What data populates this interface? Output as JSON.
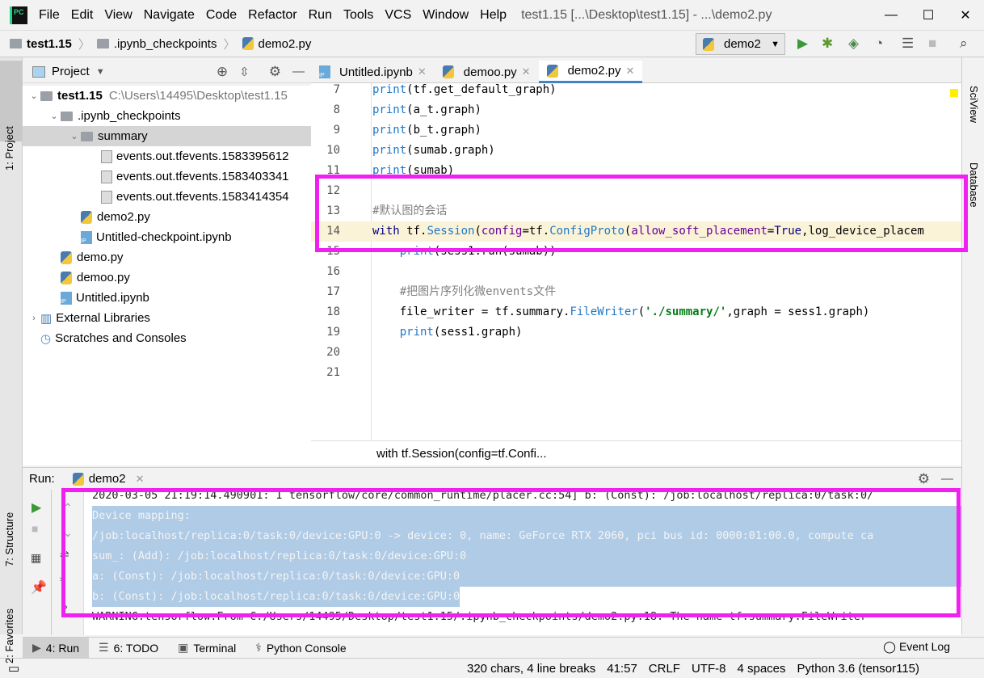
{
  "menu": {
    "items": [
      "File",
      "Edit",
      "View",
      "Navigate",
      "Code",
      "Refactor",
      "Run",
      "Tools",
      "VCS",
      "Window",
      "Help"
    ],
    "window_title": "test1.15 [...\\Desktop\\test1.15] - ...\\demo2.py"
  },
  "breadcrumb": [
    "test1.15",
    ".ipynb_checkpoints",
    "demo2.py"
  ],
  "run_config": "demo2",
  "left_stripe": {
    "project": "1: Project",
    "structure": "7: Structure",
    "favorites": "2: Favorites"
  },
  "right_stripe": {
    "sciview": "SciView",
    "database": "Database"
  },
  "project": {
    "title": "Project",
    "tree": [
      {
        "label": "test1.15",
        "path": "C:\\Users\\14495\\Desktop\\test1.15",
        "type": "folder",
        "depth": 0
      },
      {
        "label": ".ipynb_checkpoints",
        "type": "folder",
        "depth": 1
      },
      {
        "label": "summary",
        "type": "folder",
        "depth": 2,
        "selected": true
      },
      {
        "label": "events.out.tfevents.1583395612",
        "type": "file",
        "depth": 3
      },
      {
        "label": "events.out.tfevents.1583403341",
        "type": "file",
        "depth": 3
      },
      {
        "label": "events.out.tfevents.1583414354",
        "type": "file",
        "depth": 3
      },
      {
        "label": "demo2.py",
        "type": "py",
        "depth": 2
      },
      {
        "label": "Untitled-checkpoint.ipynb",
        "type": "ipynb",
        "depth": 2
      },
      {
        "label": "demo.py",
        "type": "py",
        "depth": 1
      },
      {
        "label": "demoo.py",
        "type": "py",
        "depth": 1
      },
      {
        "label": "Untitled.ipynb",
        "type": "ipynb",
        "depth": 1
      },
      {
        "label": "External Libraries",
        "type": "lib",
        "depth": 0
      },
      {
        "label": "Scratches and Consoles",
        "type": "scratch",
        "depth": 0
      }
    ]
  },
  "editor": {
    "tabs": [
      {
        "label": "Untitled.ipynb",
        "active": false
      },
      {
        "label": "demoo.py",
        "active": false
      },
      {
        "label": "demo2.py",
        "active": true
      }
    ],
    "lines": [
      {
        "n": "7",
        "text": "print(tf.get_default_graph)"
      },
      {
        "n": "8",
        "text": "print(a_t.graph)"
      },
      {
        "n": "9",
        "text": "print(b_t.graph)"
      },
      {
        "n": "10",
        "text": "print(sumab.graph)"
      },
      {
        "n": "11",
        "text": "print(sumab)"
      },
      {
        "n": "12",
        "text": ""
      },
      {
        "n": "13",
        "text": "#默认图的会话"
      },
      {
        "n": "14",
        "text": "with tf.Session(config=tf.ConfigProto(allow_soft_placement=True,log_device_placem"
      },
      {
        "n": "15",
        "text": "    print(sess1.run(sumab))"
      },
      {
        "n": "16",
        "text": ""
      },
      {
        "n": "17",
        "text": "    #把图片序列化微envents文件"
      },
      {
        "n": "18",
        "text": "    file_writer = tf.summary.FileWriter('./summary/',graph = sess1.graph)"
      },
      {
        "n": "19",
        "text": "    print(sess1.graph)"
      },
      {
        "n": "20",
        "text": ""
      },
      {
        "n": "21",
        "text": ""
      }
    ],
    "current_line": "14",
    "code_breadcrumb": "with tf.Session(config=tf.Confi..."
  },
  "run": {
    "label": "Run:",
    "tab": "demo2",
    "lines": [
      {
        "text": "2020-03-05 21:19:14.490901: I tensorflow/core/common_runtime/placer.cc:54] b: (Const): /job:localhost/replica:0/task:0/",
        "selected": false
      },
      {
        "text": "Device mapping:",
        "selected": true
      },
      {
        "text": "/job:localhost/replica:0/task:0/device:GPU:0 -> device: 0, name: GeForce RTX 2060, pci bus id: 0000:01:00.0, compute ca",
        "selected": true
      },
      {
        "text": "sum_: (Add): /job:localhost/replica:0/task:0/device:GPU:0",
        "selected": true
      },
      {
        "text": "a: (Const): /job:localhost/replica:0/task:0/device:GPU:0",
        "selected": true
      },
      {
        "text": "b: (Const): /job:localhost/replica:0/task:0/device:GPU:0",
        "selected": true
      },
      {
        "text": "WARNING:tensorflow:From C:/Users/14495/Desktop/test1.15/.ipynb_checkpoints/demo2.py:18: The name tf.summary.FileWriter",
        "selected": false
      }
    ]
  },
  "bottom_tabs": [
    "4: Run",
    "6: TODO",
    "Terminal",
    "Python Console"
  ],
  "event_log": "Event Log",
  "status": {
    "selection": "320 chars, 4 line breaks",
    "position": "41:57",
    "line_sep": "CRLF",
    "encoding": "UTF-8",
    "indent": "4 spaces",
    "interpreter": "Python 3.6 (tensor115)"
  },
  "colors": {
    "annotation": "#f020f0",
    "selection": "#afcbe6",
    "current_line": "#fbf3d7"
  }
}
